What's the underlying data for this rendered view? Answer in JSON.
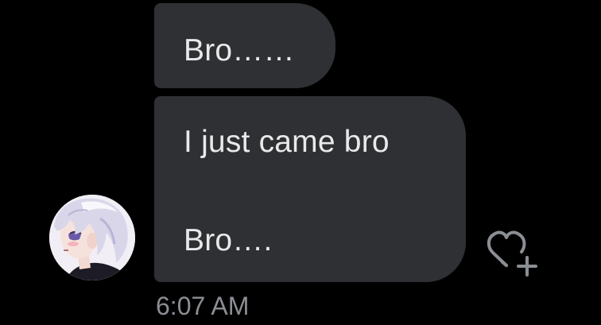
{
  "conversation": {
    "messages": [
      {
        "lines": [
          "Bro……"
        ]
      },
      {
        "lines": [
          "I just came bro",
          "Bro…."
        ]
      }
    ],
    "timestamp": "6:07 AM",
    "sender": {
      "avatar_icon": "anime-avatar-image"
    },
    "actions": {
      "like_icon": "heart-plus-icon"
    }
  },
  "colors": {
    "background": "#000000",
    "bubble": "#2f3033",
    "bubble_text": "#e9e9ea",
    "timestamp": "#8b8e93",
    "icon": "#8b8e93"
  }
}
